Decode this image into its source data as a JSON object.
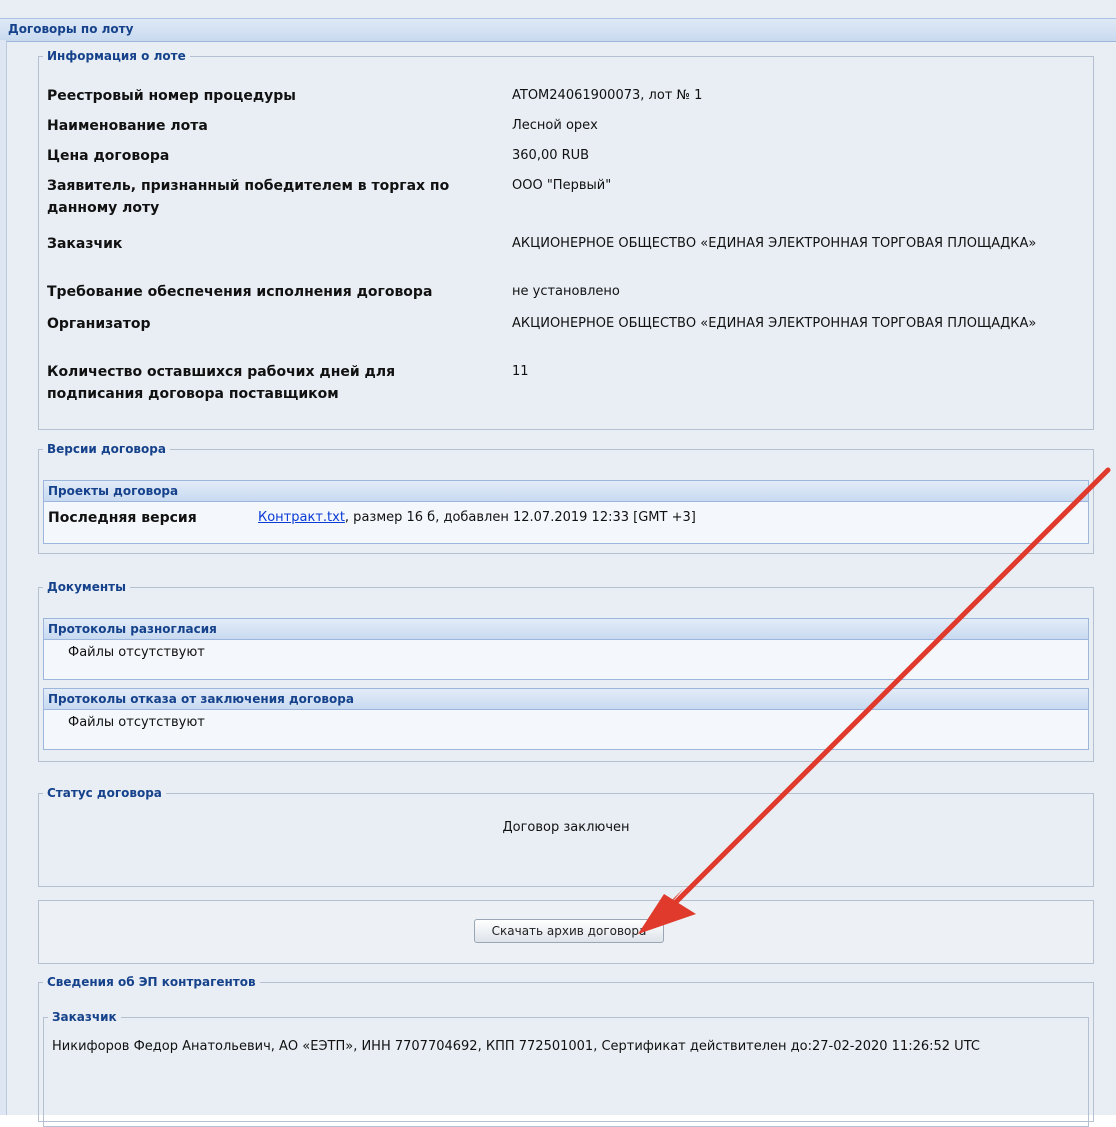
{
  "window": {
    "title": "Договоры по лоту"
  },
  "lot_info": {
    "legend": "Информация о лоте",
    "fields": [
      {
        "label": "Реестровый номер процедуры",
        "value": "ATOM24061900073, лот № 1"
      },
      {
        "label": "Наименование лота",
        "value": "Лесной орех"
      },
      {
        "label": "Цена договора",
        "value": "360,00 RUB"
      },
      {
        "label": "Заявитель, признанный победителем в торгах по данному лоту",
        "value": "ООО \"Первый\""
      },
      {
        "label": "Заказчик",
        "value": "АКЦИОНЕРНОЕ ОБЩЕСТВО «ЕДИНАЯ ЭЛЕКТРОННАЯ ТОРГОВАЯ ПЛОЩАДКА»"
      },
      {
        "label": "Требование обеспечения исполнения договора",
        "value": "не установлено"
      },
      {
        "label": "Организатор",
        "value": "АКЦИОНЕРНОЕ ОБЩЕСТВО «ЕДИНАЯ ЭЛЕКТРОННАЯ ТОРГОВАЯ ПЛОЩАДКА»"
      },
      {
        "label": "Количество оставшихся рабочих дней для подписания договора поставщиком",
        "value": "11"
      }
    ]
  },
  "versions": {
    "legend": "Версии договора",
    "panel_title": "Проекты договора",
    "latest_label": "Последняя версия",
    "file_link": "Контракт.txt",
    "file_info": ", размер 16 б, добавлен 12.07.2019 12:33 [GMT +3]"
  },
  "documents": {
    "legend": "Документы",
    "panels": [
      {
        "title": "Протоколы разногласия",
        "empty_text": "Файлы отсутствуют"
      },
      {
        "title": "Протоколы отказа от заключения договора",
        "empty_text": "Файлы отсутствуют"
      }
    ]
  },
  "status": {
    "legend": "Статус договора",
    "text": "Договор заключен"
  },
  "download": {
    "button_label": "Скачать архив договора"
  },
  "signatures": {
    "legend": "Сведения об ЭП контрагентов",
    "customer_legend": "Заказчик",
    "customer_text": "Никифоров Федор Анатольевич, АО «ЕЭТП», ИНН 7707704692, КПП 772501001, Сертификат действителен до:27-02-2020 11:26:52 UTC"
  },
  "colors": {
    "header_text": "#15428b",
    "background": "#e9eef5",
    "link": "#0a3bd6",
    "arrow": "#e03a2c"
  },
  "icons": {
    "annotation": "red-arrow-icon"
  }
}
